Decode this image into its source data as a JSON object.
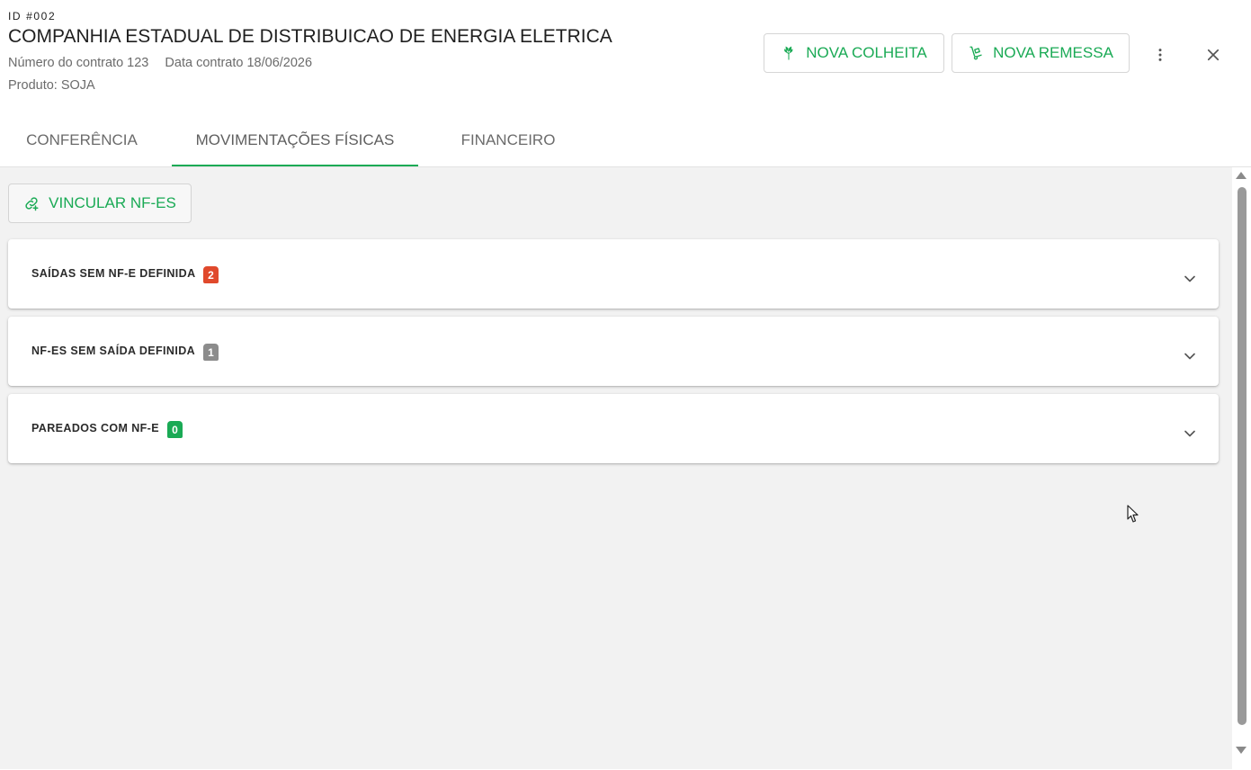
{
  "header": {
    "record_id": "ID #002",
    "company_name": "COMPANHIA ESTADUAL DE DISTRIBUICAO DE ENERGIA ELETRICA",
    "contract_number": "Número do contrato 123",
    "contract_date": "Data contrato 18/06/2026",
    "product": "Produto: SOJA",
    "actions": {
      "nova_colheita": "NOVA COLHEITA",
      "nova_remessa": "NOVA REMESSA"
    },
    "icons": {
      "colheita": "wheat-icon",
      "remessa": "hand-truck-icon",
      "more": "more-vertical-icon",
      "close": "close-icon"
    }
  },
  "tabs": [
    {
      "label": "CONFERÊNCIA",
      "active": false
    },
    {
      "label": "MOVIMENTAÇÕES FÍSICAS",
      "active": true
    },
    {
      "label": "FINANCEIRO",
      "active": false
    }
  ],
  "content": {
    "vincular_button": "VINCULAR NF-ES",
    "panels": [
      {
        "title": "SAÍDAS SEM NF-E DEFINIDA",
        "count": "2",
        "badge_color": "#e0492c"
      },
      {
        "title": "NF-ES SEM SAÍDA DEFINIDA",
        "count": "1",
        "badge_color": "#8c8c8c"
      },
      {
        "title": "PAREADOS COM NF-E",
        "count": "0",
        "badge_color": "#1aaa55"
      }
    ]
  },
  "colors": {
    "accent": "#1aaa55",
    "background": "#f2f2f2",
    "text_muted": "#6b6b6b"
  }
}
